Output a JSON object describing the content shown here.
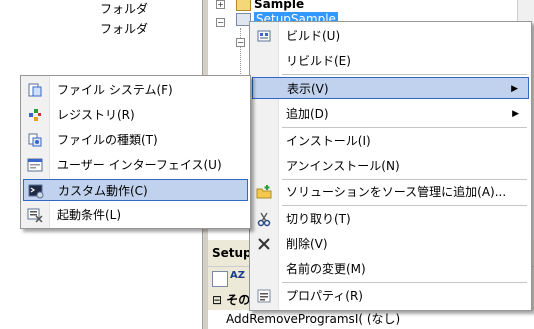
{
  "background": {
    "folders": [
      "フォルダ",
      "フォルダ"
    ],
    "tree": {
      "sample_label": "Sample",
      "setup_label": "SetupSample"
    },
    "properties": {
      "header": "Setup",
      "category": "その",
      "row_name": "AddRemoveProgramsI(",
      "row_value": "(なし)"
    }
  },
  "context_menu": {
    "items": [
      {
        "label": "ビルド(U)",
        "icon": "build-icon"
      },
      {
        "label": "リビルド(E)",
        "icon": ""
      },
      {
        "label": "表示(V)",
        "icon": "",
        "submenu": true,
        "highlighted": true
      },
      {
        "label": "追加(D)",
        "icon": "",
        "submenu": true
      },
      {
        "label": "インストール(I)",
        "icon": ""
      },
      {
        "label": "アンインストール(N)",
        "icon": ""
      },
      {
        "label": "ソリューションをソース管理に追加(A)...",
        "icon": "source-control-add-icon"
      },
      {
        "label": "切り取り(T)",
        "icon": "scissors-icon"
      },
      {
        "label": "削除(V)",
        "icon": "delete-x-icon"
      },
      {
        "label": "名前の変更(M)",
        "icon": ""
      },
      {
        "label": "プロパティ(R)",
        "icon": "properties-icon"
      }
    ]
  },
  "view_submenu": {
    "items": [
      {
        "label": "ファイル システム(F)",
        "icon": "file-system-icon"
      },
      {
        "label": "レジストリ(R)",
        "icon": "registry-icon"
      },
      {
        "label": "ファイルの種類(T)",
        "icon": "file-types-icon"
      },
      {
        "label": "ユーザー インターフェイス(U)",
        "icon": "user-interface-icon"
      },
      {
        "label": "カスタム動作(C)",
        "icon": "custom-actions-icon",
        "highlighted": true
      },
      {
        "label": "起動条件(L)",
        "icon": "launch-conditions-icon"
      }
    ]
  },
  "colors": {
    "highlight_fill": "#c1d2ee",
    "highlight_border": "#316ac5",
    "selection": "#3399ff"
  }
}
